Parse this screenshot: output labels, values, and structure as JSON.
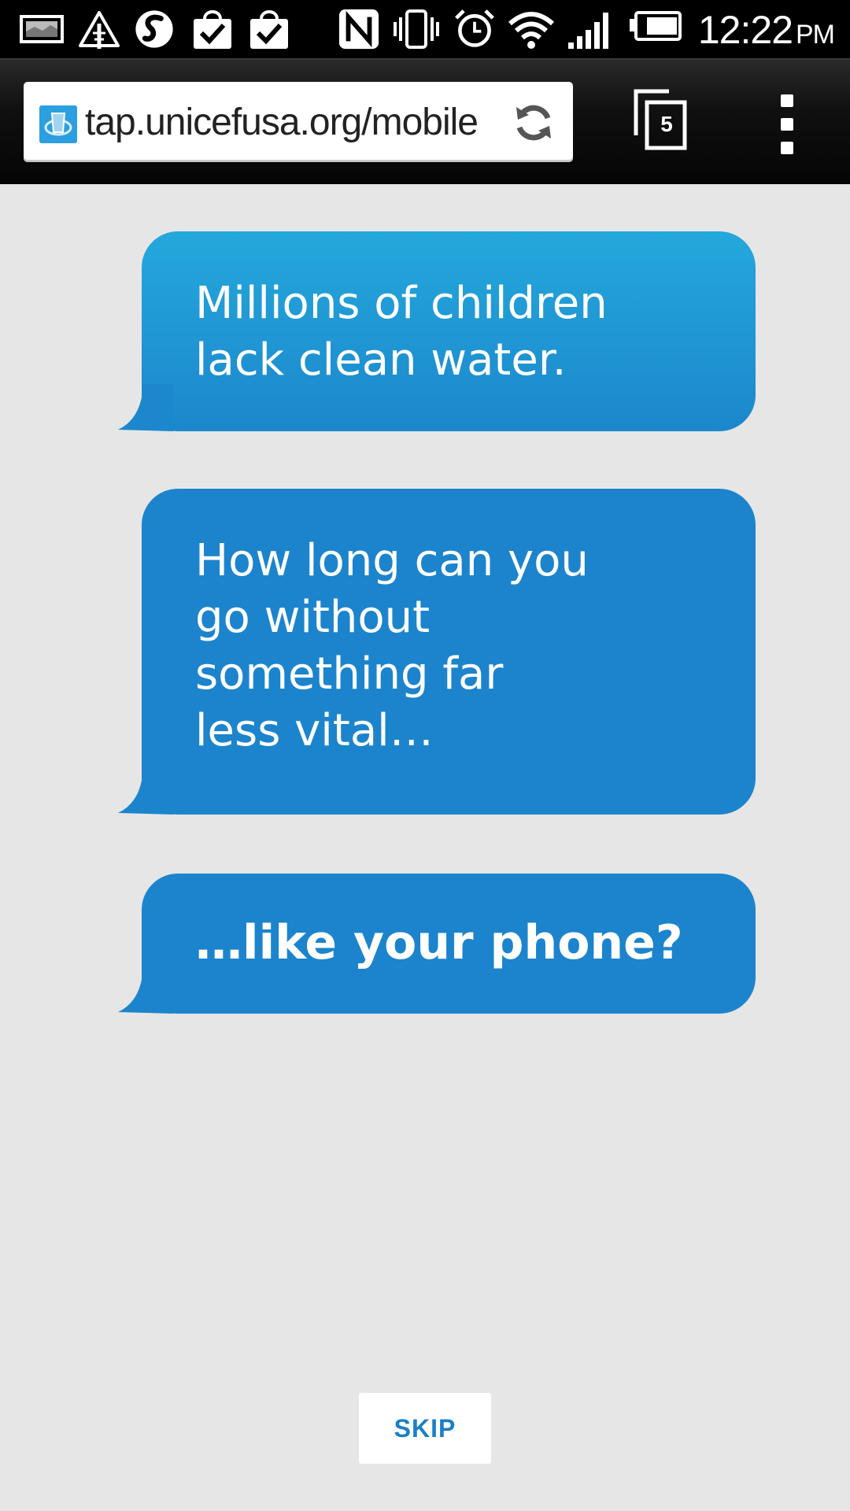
{
  "status_bar": {
    "time": "12:22",
    "ampm": "PM",
    "icons": [
      "gallery-icon",
      "alert-icon",
      "s-app-icon",
      "shopping-bag-check-icon",
      "shopping-bag-check-icon",
      "nfc-icon",
      "vibrate-icon",
      "alarm-icon",
      "wifi-icon",
      "signal-icon",
      "battery-icon"
    ]
  },
  "browser": {
    "url": "tap.unicefusa.org/mobile",
    "tab_count": "5"
  },
  "messages": [
    {
      "text": "Millions of children\nlack clean water."
    },
    {
      "text": "How long can you\ngo without\nsomething far\nless vital…"
    },
    {
      "text": "…like your phone?"
    }
  ],
  "skip_label": "SKIP",
  "colors": {
    "bubble_light": "#24a8dc",
    "bubble": "#1c84cc",
    "background": "#e6e6e6",
    "skip_text": "#1b7fc6"
  }
}
